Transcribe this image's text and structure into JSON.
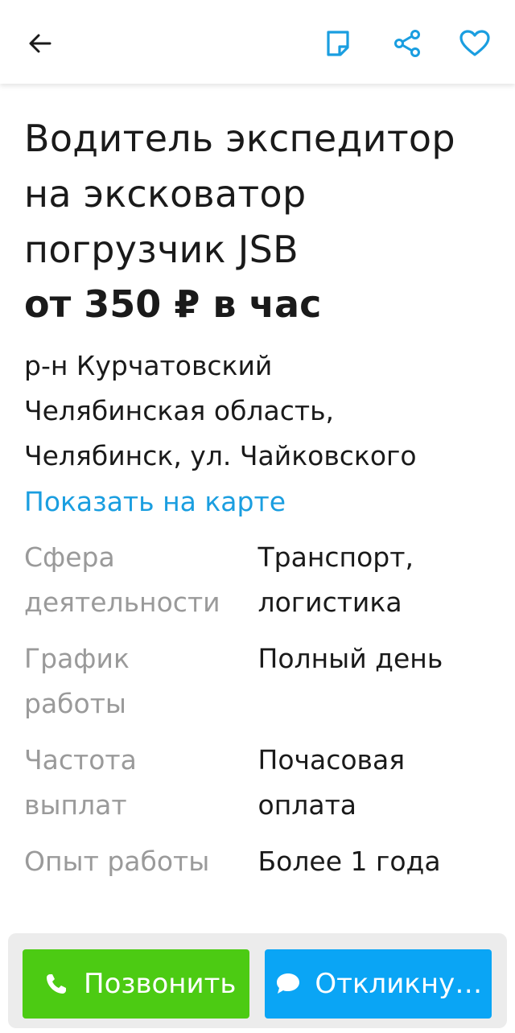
{
  "header": {
    "back_icon": "arrow-left-icon",
    "note_icon": "note-icon",
    "share_icon": "share-icon",
    "favorite_icon": "heart-icon",
    "accent_color": "#1a9ee0"
  },
  "vacancy": {
    "title_lines": [
      "Водитель экспедитор",
      "на экскoватор",
      "погрузчик JSB"
    ],
    "salary": "от 350 ₽ в час",
    "address_lines": [
      "р-н Курчатовский",
      "Челябинская область,",
      "Челябинск, ул. Чайковского"
    ],
    "map_link": "Показать на карте"
  },
  "details": [
    {
      "label_lines": [
        "Сфера",
        "деятельности"
      ],
      "value_lines": [
        "Транспорт,",
        "логистика"
      ]
    },
    {
      "label_lines": [
        "График",
        "работы"
      ],
      "value_lines": [
        "Полный день"
      ]
    },
    {
      "label_lines": [
        "Частота",
        "выплат"
      ],
      "value_lines": [
        "Почасовая",
        "оплата"
      ]
    },
    {
      "label_lines": [
        "Опыт работы"
      ],
      "value_lines": [
        "Более 1 года"
      ]
    }
  ],
  "actions": {
    "call_label": "Позвонить",
    "call_icon": "phone-icon",
    "call_color": "#4ccb13",
    "respond_label": "Откликнуться",
    "respond_icon": "chat-bubble-icon",
    "respond_color": "#0aa5f5"
  }
}
